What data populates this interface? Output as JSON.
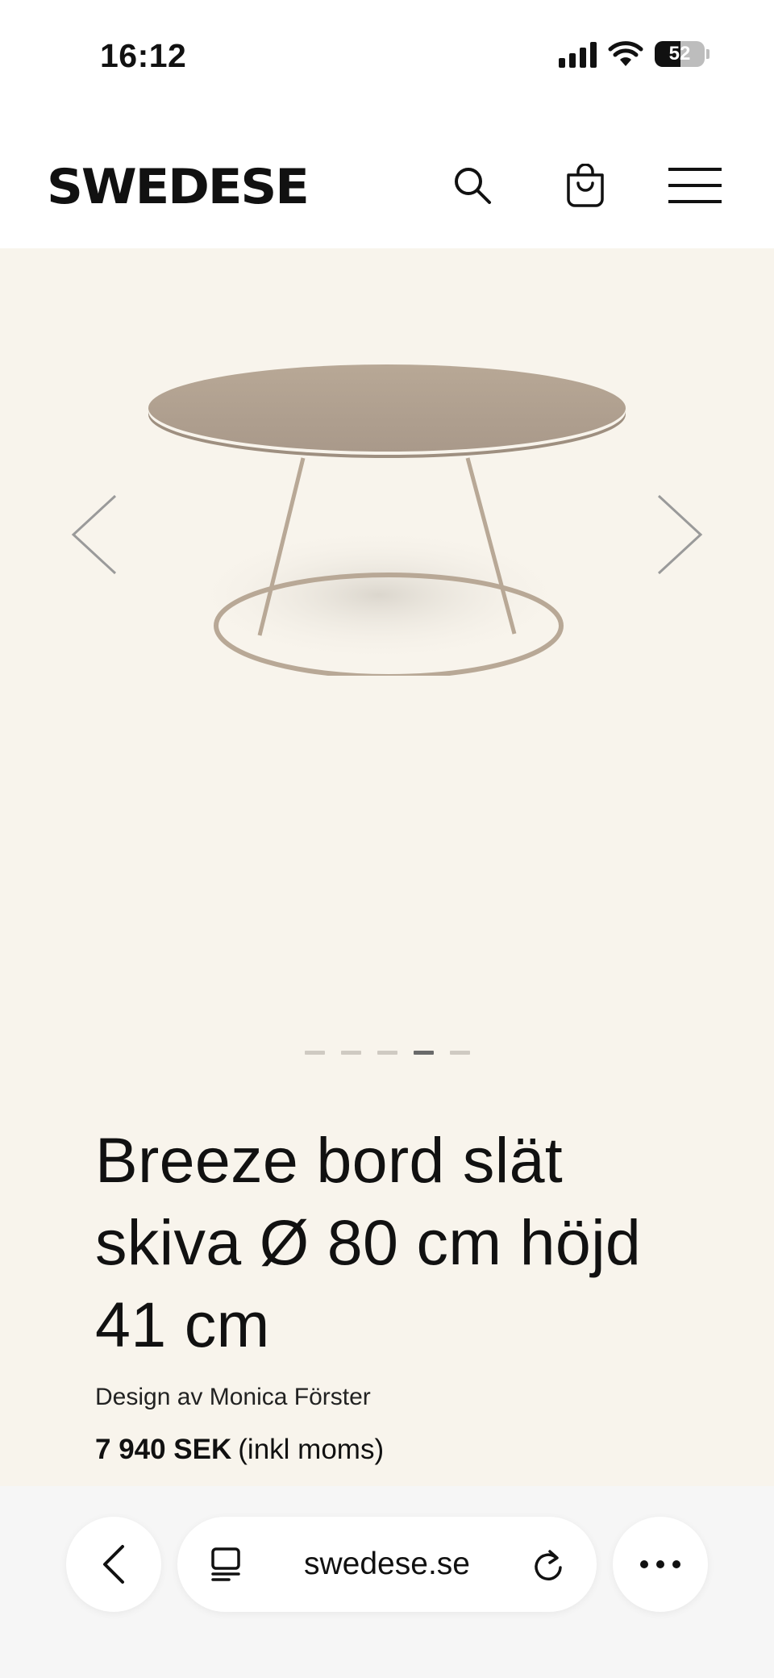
{
  "status_bar": {
    "time": "16:12",
    "battery": "52",
    "icons": [
      "signal-icon",
      "wifi-icon",
      "battery-icon"
    ]
  },
  "header": {
    "logo": "SWEDESE",
    "icons": [
      "search-icon",
      "shopping-bag-icon",
      "hamburger-menu-icon"
    ]
  },
  "gallery": {
    "image_alt": "Breeze bord",
    "slide_count": 5,
    "active_slide": 4,
    "icons": [
      "chevron-left-icon",
      "chevron-right-icon"
    ]
  },
  "product": {
    "title": "Breeze bord slät skiva Ø 80 cm höjd 41 cm",
    "designer": "Design av Monica Förster",
    "price": "7 940 SEK",
    "price_note": "(inkl moms)"
  },
  "browser": {
    "url": "swedese.se",
    "icons": [
      "back-icon",
      "tabs-icon",
      "reload-icon",
      "more-icon"
    ]
  },
  "colors": {
    "page_bg": "#f8f4ec",
    "table_color": "#b5a594",
    "text": "#111111"
  }
}
